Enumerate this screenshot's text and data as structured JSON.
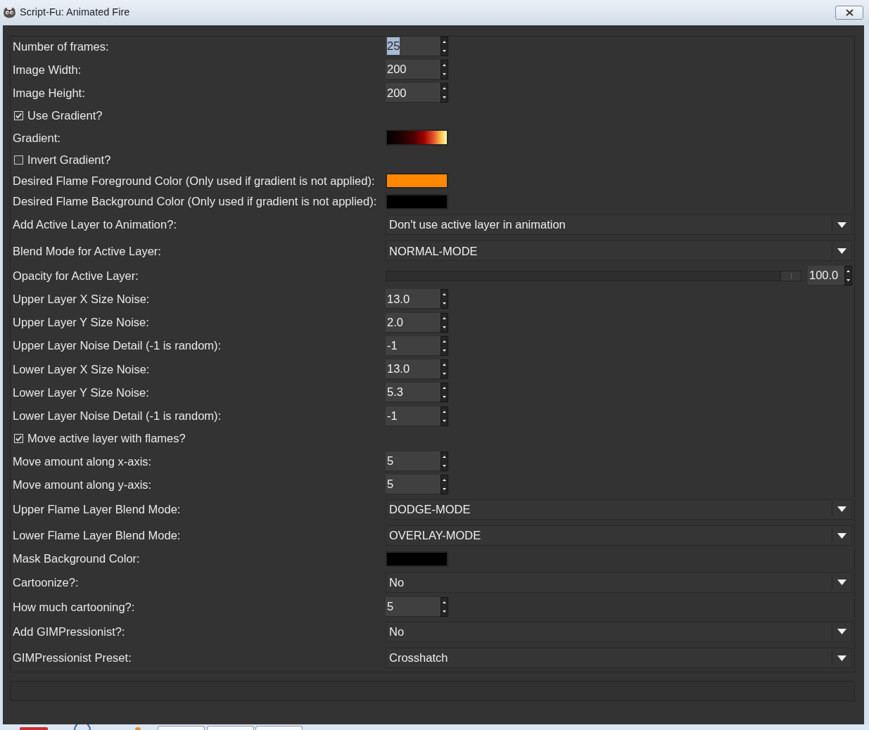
{
  "window": {
    "title": "Script-Fu: Animated Fire"
  },
  "fields": [
    {
      "kind": "spin",
      "label": "Number of frames:",
      "value": "25",
      "text_selected": true
    },
    {
      "kind": "spin",
      "label": "Image Width:",
      "value": "200",
      "text_selected": false
    },
    {
      "kind": "spin",
      "label": "Image Height:",
      "value": "200",
      "text_selected": false
    },
    {
      "kind": "checkbox",
      "label": "Use Gradient?",
      "checked": true
    },
    {
      "kind": "gradient",
      "label": "Gradient:"
    },
    {
      "kind": "checkbox",
      "label": "Invert Gradient?",
      "checked": false
    },
    {
      "kind": "color",
      "label": "Desired Flame Foreground Color (Only used if gradient is not applied):",
      "color": "#ff8800"
    },
    {
      "kind": "color",
      "label": "Desired Flame Background Color (Only used if gradient is not applied):",
      "color": "#000000"
    },
    {
      "kind": "dropdown",
      "label": "Add Active Layer to Animation?:",
      "value": "Don't use active layer in animation"
    },
    {
      "kind": "dropdown",
      "label": "Blend Mode for Active Layer:",
      "value": "NORMAL-MODE"
    },
    {
      "kind": "slider",
      "label": "Opacity for Active Layer:",
      "level": 1,
      "value": "100.0"
    },
    {
      "kind": "spin",
      "label": "Upper Layer X Size Noise:",
      "value": "13.0",
      "text_selected": false
    },
    {
      "kind": "spin",
      "label": "Upper Layer Y Size Noise:",
      "value": "2.0",
      "text_selected": false
    },
    {
      "kind": "spin",
      "label": "Upper Layer Noise Detail (-1 is random):",
      "value": "-1",
      "text_selected": false
    },
    {
      "kind": "spin",
      "label": "Lower Layer X Size Noise:",
      "value": "13.0",
      "text_selected": false
    },
    {
      "kind": "spin",
      "label": "Lower Layer Y Size Noise:",
      "value": "5.3",
      "text_selected": false
    },
    {
      "kind": "spin",
      "label": "Lower Layer Noise Detail (-1 is random):",
      "value": "-1",
      "text_selected": false
    },
    {
      "kind": "checkbox",
      "label": "Move active layer with flames?",
      "checked": true
    },
    {
      "kind": "spin",
      "label": "Move amount along x-axis:",
      "value": "5",
      "text_selected": false
    },
    {
      "kind": "spin",
      "label": "Move amount along y-axis:",
      "value": "5",
      "text_selected": false
    },
    {
      "kind": "dropdown",
      "label": "Upper Flame Layer Blend Mode:",
      "value": "DODGE-MODE"
    },
    {
      "kind": "dropdown",
      "label": "Lower Flame Layer Blend Mode:",
      "value": "OVERLAY-MODE"
    },
    {
      "kind": "color",
      "label": "Mask Background Color:",
      "color": "#000000"
    },
    {
      "kind": "dropdown",
      "label": "Cartoonize?:",
      "value": "No"
    },
    {
      "kind": "spin",
      "label": "How much cartooning?:",
      "value": "5",
      "text_selected": false
    },
    {
      "kind": "dropdown",
      "label": "Add GIMPressionist?:",
      "value": "No"
    },
    {
      "kind": "dropdown",
      "label": "GIMPressionist Preset:",
      "value": "Crosshatch"
    }
  ]
}
